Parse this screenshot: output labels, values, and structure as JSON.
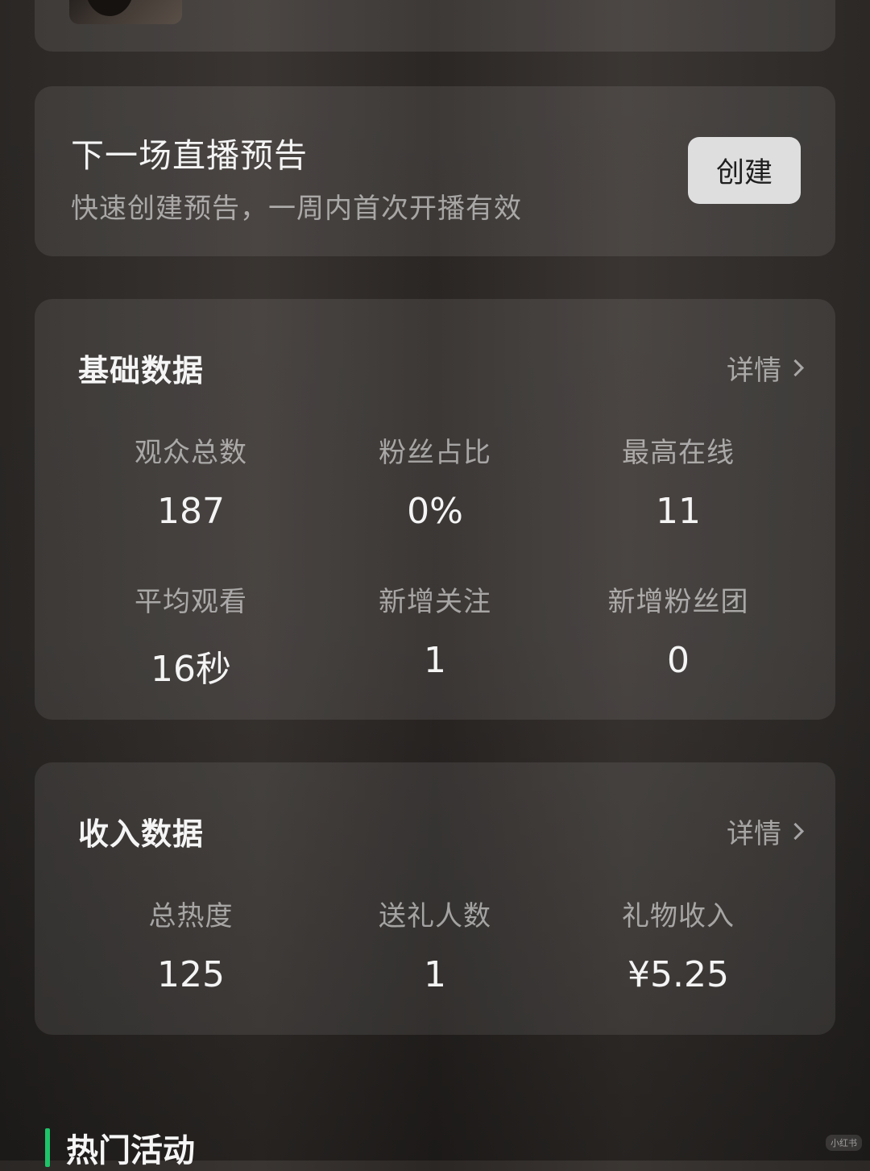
{
  "preview": {
    "title": "下一场直播预告",
    "subtitle": "快速创建预告，一周内首次开播有效",
    "create_label": "创建"
  },
  "basic": {
    "title": "基础数据",
    "detail_label": "详情",
    "stats": [
      {
        "label": "观众总数",
        "value": "187"
      },
      {
        "label": "粉丝占比",
        "value": "0%"
      },
      {
        "label": "最高在线",
        "value": "11"
      },
      {
        "label": "平均观看",
        "value": "16秒"
      },
      {
        "label": "新增关注",
        "value": "1"
      },
      {
        "label": "新增粉丝团",
        "value": "0"
      }
    ]
  },
  "income": {
    "title": "收入数据",
    "detail_label": "详情",
    "stats": [
      {
        "label": "总热度",
        "value": "125"
      },
      {
        "label": "送礼人数",
        "value": "1"
      },
      {
        "label": "礼物收入",
        "value": "¥5.25"
      }
    ]
  },
  "hot": {
    "title": "热门活动"
  },
  "watermark": "小红书",
  "colors": {
    "accent": "#1ec46a",
    "button_bg": "#dedede"
  }
}
